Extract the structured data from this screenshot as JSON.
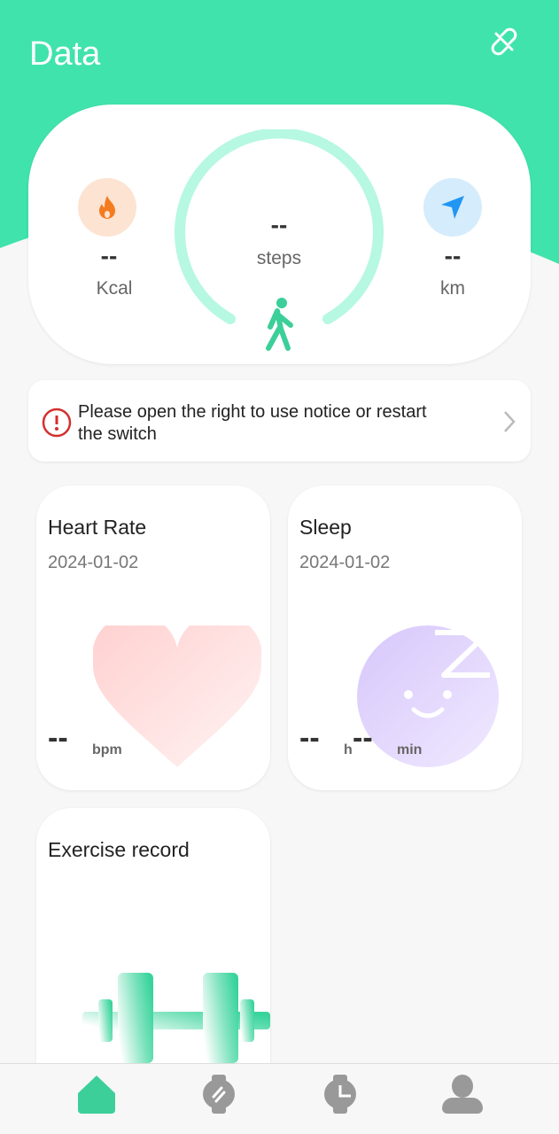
{
  "header": {
    "title": "Data",
    "link_icon": "unlink-icon"
  },
  "summary": {
    "calories": {
      "value": "--",
      "unit": "Kcal"
    },
    "steps": {
      "value": "--",
      "unit": "steps"
    },
    "distance": {
      "value": "--",
      "unit": "km"
    }
  },
  "notice": {
    "text": "Please open the right to use notice or restart the switch"
  },
  "heart": {
    "title": "Heart Rate",
    "date": "2024-01-02",
    "value": "--",
    "unit": "bpm"
  },
  "sleep": {
    "title": "Sleep",
    "date": "2024-01-02",
    "hours": "--",
    "h_unit": "h",
    "minutes": "--",
    "min_unit": "min"
  },
  "exercise": {
    "title": "Exercise record"
  },
  "colors": {
    "accent": "#40e3ab",
    "ring": "#b6f8e2",
    "calorie": "#f47c20",
    "distance": "#2196f3",
    "inactive": "#999999"
  },
  "nav": [
    {
      "icon": "home-icon",
      "active": true
    },
    {
      "icon": "watch-icon",
      "active": false
    },
    {
      "icon": "watch-clock-icon",
      "active": false
    },
    {
      "icon": "profile-icon",
      "active": false
    }
  ]
}
